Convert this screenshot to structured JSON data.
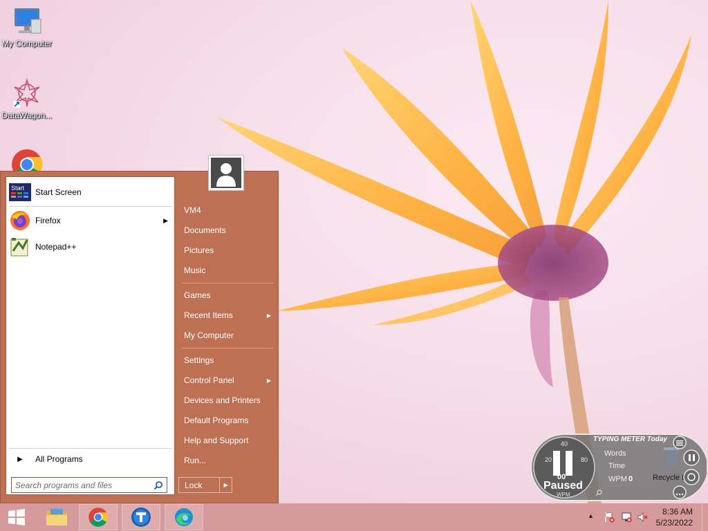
{
  "desktop": {
    "icons": [
      {
        "label": "My Computer",
        "icon": "my-computer-icon"
      },
      {
        "label": "DataWagon...",
        "icon": "datawagon-icon"
      },
      {
        "label": "",
        "icon": "chrome-icon"
      }
    ]
  },
  "start_menu": {
    "programs": [
      {
        "label": "Start Screen",
        "icon": "start-screen-icon",
        "submenu": false
      },
      {
        "label": "Firefox",
        "icon": "firefox-icon",
        "submenu": true
      },
      {
        "label": "Notepad++",
        "icon": "notepadpp-icon",
        "submenu": false
      }
    ],
    "all_programs": "All Programs",
    "search_placeholder": "Search programs and files",
    "start_tile_text": "Start",
    "right_items": [
      {
        "label": "VM4",
        "submenu": false
      },
      {
        "label": "Documents",
        "submenu": false
      },
      {
        "label": "Pictures",
        "submenu": false
      },
      {
        "label": "Music",
        "submenu": false
      },
      {
        "label": "Games",
        "submenu": false
      },
      {
        "label": "Recent Items",
        "submenu": true
      },
      {
        "label": "My Computer",
        "submenu": false
      },
      {
        "label": "Settings",
        "submenu": false
      },
      {
        "label": "Control Panel",
        "submenu": true
      },
      {
        "label": "Devices and Printers",
        "submenu": false
      },
      {
        "label": "Default Programs",
        "submenu": false
      },
      {
        "label": "Help and Support",
        "submenu": false
      },
      {
        "label": "Run...",
        "submenu": false
      }
    ],
    "lock_label": "Lock"
  },
  "typing_meter": {
    "title": "TYPING METER Today",
    "words_label": "Words",
    "time_label": "Time",
    "wpm_label": "WPM",
    "wpm_value": "0",
    "gauge_value": "00",
    "status": "Paused",
    "gauge_unit": "WPM",
    "ticks": [
      "20",
      "40",
      "80"
    ],
    "recycle_label": "Recycle Bin"
  },
  "taskbar": {
    "buttons": [
      {
        "name": "start-button",
        "icon": "windows-icon"
      },
      {
        "name": "file-explorer-button",
        "icon": "file-explorer-icon"
      },
      {
        "name": "chrome-button",
        "icon": "chrome-icon"
      },
      {
        "name": "typing-meter-button",
        "icon": "typing-meter-icon"
      },
      {
        "name": "edge-button",
        "icon": "edge-icon"
      }
    ],
    "time": "8:36 AM",
    "date": "5/23/2022"
  },
  "colors": {
    "start_menu_bg": "#bd7053",
    "taskbar_bg": "#d79a9c"
  }
}
